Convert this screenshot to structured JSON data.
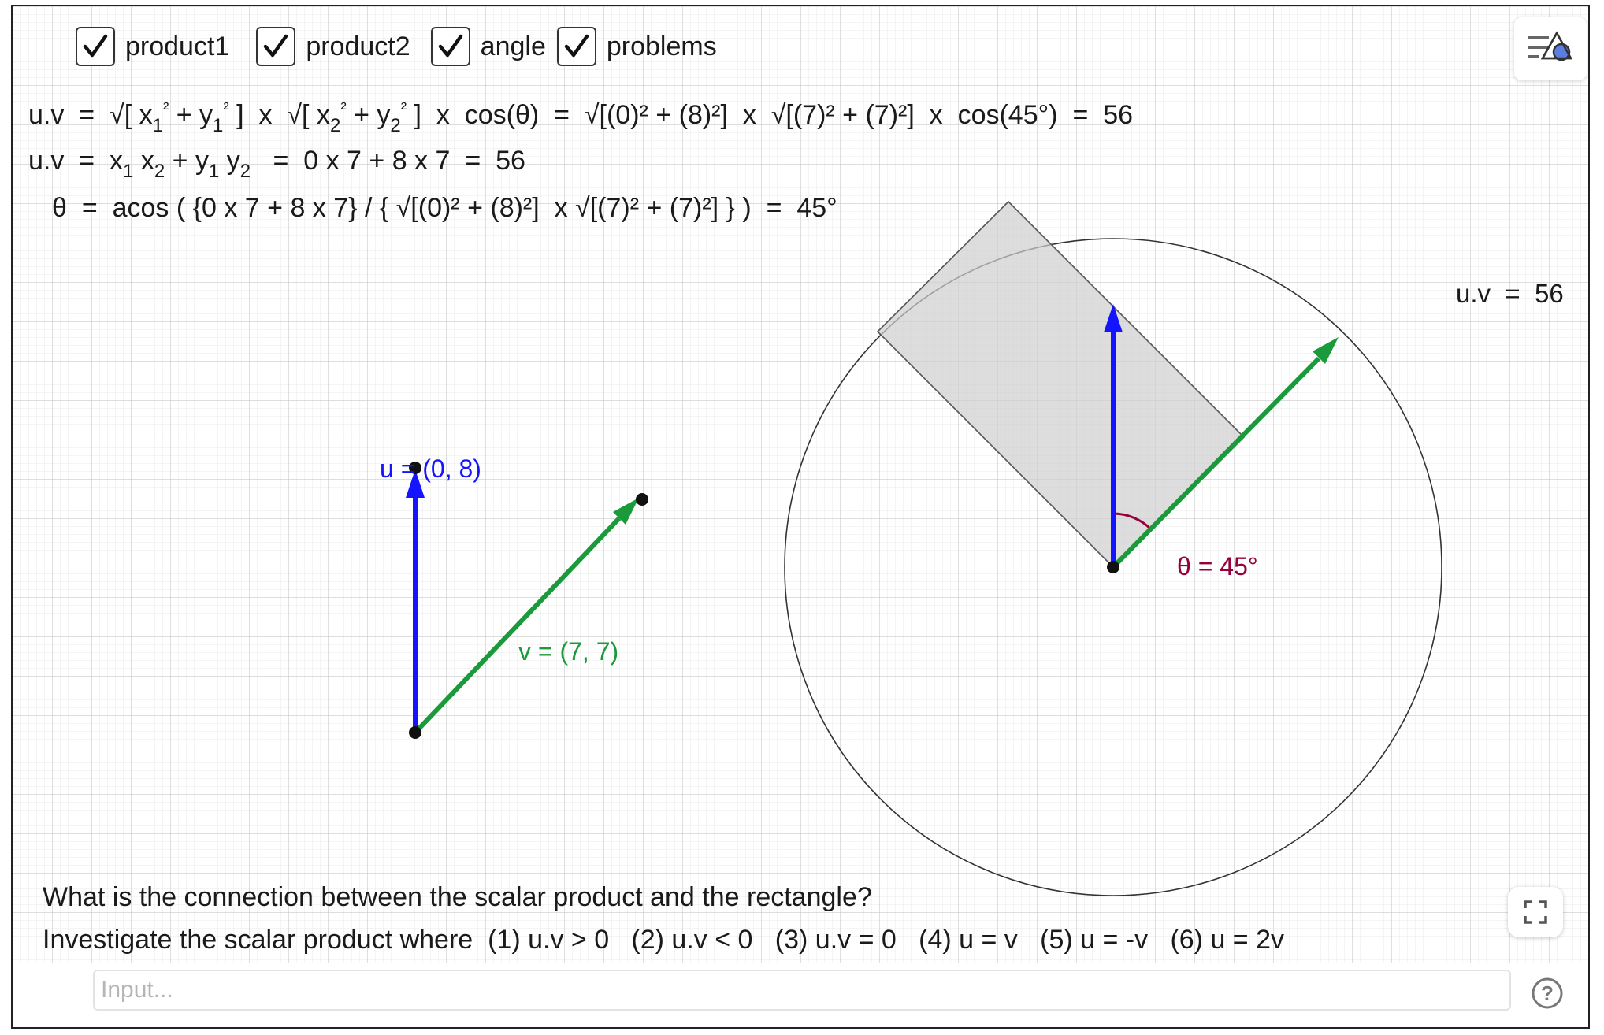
{
  "checkboxes": [
    {
      "label": "product1",
      "checked": true
    },
    {
      "label": "product2",
      "checked": true
    },
    {
      "label": "angle",
      "checked": true
    },
    {
      "label": "problems",
      "checked": true
    }
  ],
  "formulas": {
    "line1": {
      "lhs": "u.v",
      "eq": "=",
      "sqrt1_open": "√[ x",
      "sub1": "1",
      "sup1": "²",
      "plus1": " + y",
      "sub2": "1",
      "sup2": "²",
      "close1": " ]  x  √[ x",
      "sub3": "2",
      "sup3": "²",
      "plus2": " + y",
      "sub4": "2",
      "sup4": "²",
      "close2": " ]  x  cos(θ)",
      "eq2": "=",
      "numeric": "√[(0)² + (8)²]  x  √[(7)² + (7)²]  x  cos(45°)",
      "eq3": "=",
      "result": "56"
    },
    "line2": {
      "lhs": "u.v",
      "eq": "=",
      "x": "x",
      "sub1": "1",
      "x2": " x",
      "sub2": "2",
      "plus": " + y",
      "sub3": "1",
      "y2": " y",
      "sub4": "2",
      "eq2": "=",
      "numeric": "0 x 7 + 8 x 7",
      "eq3": "=",
      "result": "56"
    },
    "line3": {
      "lhs": "θ",
      "eq": "=",
      "expr": "acos ( {0 x 7 + 8 x 7} / { √[(0)² + (8)²]  x √[(7)² + (7)²] } )",
      "eq2": "=",
      "result": "45°"
    }
  },
  "side_label": "u.v  =  56",
  "labels": {
    "u_vector": "u = (0, 8)",
    "v_vector": "v = (7, 7)",
    "angle": "θ = 45°"
  },
  "questions": {
    "line1": "What is the connection between the scalar product and the rectangle?",
    "line2": "Investigate the scalar product where  (1) u.v > 0   (2) u.v < 0   (3) u.v = 0   (4) u = v   (5) u = -v   (6) u = 2v"
  },
  "input": {
    "placeholder": "Input...",
    "value": ""
  },
  "icons": {
    "menu": "algebra-menu-icon",
    "fullscreen": "fullscreen-icon",
    "help": "help-icon",
    "check": "check-icon"
  },
  "colors": {
    "u_vector": "#1414ff",
    "v_vector": "#1a9a3a",
    "angle": "#99003a",
    "rectangle_fill": "#d8d8d8",
    "grid_minor": "#e6e6e6",
    "grid_major": "#c8c8c8"
  },
  "vectors": {
    "u": {
      "x": 0,
      "y": 8
    },
    "v": {
      "x": 7,
      "y": 7
    },
    "angle_deg": 45,
    "dot_product": 56
  }
}
